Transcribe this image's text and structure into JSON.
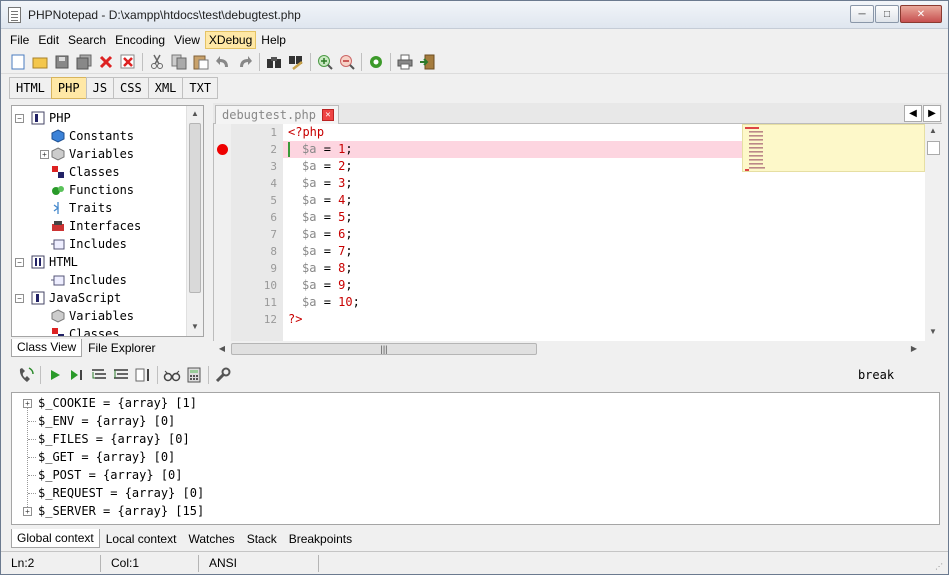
{
  "window": {
    "title": "PHPNotepad - D:\\xampp\\htdocs\\test\\debugtest.php"
  },
  "menu": [
    "File",
    "Edit",
    "Search",
    "Encoding",
    "View",
    "XDebug",
    "Help"
  ],
  "menu_active": "XDebug",
  "toolbar_icons": [
    "new-file-icon",
    "open-file-icon",
    "save-icon",
    "save-all-icon",
    "close-icon",
    "close-all-icon",
    "cut-icon",
    "copy-icon",
    "paste-icon",
    "undo-icon",
    "redo-icon",
    "find-icon",
    "replace-icon",
    "zoom-in-icon",
    "zoom-out-icon",
    "settings-icon",
    "print-icon",
    "exit-icon"
  ],
  "lang_tabs": [
    "HTML",
    "PHP",
    "JS",
    "CSS",
    "XML",
    "TXT"
  ],
  "lang_active": "PHP",
  "tree": {
    "php_root": "PHP",
    "php_children": [
      "Constants",
      "Variables",
      "Classes",
      "Functions",
      "Traits",
      "Interfaces",
      "Includes"
    ],
    "html_root": "HTML",
    "html_children": [
      "Includes"
    ],
    "js_root": "JavaScript",
    "js_children": [
      "Variables",
      "Classes"
    ]
  },
  "left_tabs": [
    "Class View",
    "File Explorer"
  ],
  "editor": {
    "tab_name": "debugtest.php",
    "open_tag": "<?php",
    "close_tag": "?>",
    "assign_var": "$a",
    "assign_op": "=",
    "assign_values": [
      "1",
      "2",
      "3",
      "4",
      "5",
      "6",
      "7",
      "8",
      "9",
      "10"
    ],
    "line_numbers": [
      "1",
      "2",
      "3",
      "4",
      "5",
      "6",
      "7",
      "8",
      "9",
      "10",
      "11",
      "12"
    ],
    "current_line": 2,
    "breakpoint_line": 2
  },
  "debug": {
    "status": "break",
    "variables": [
      "$_COOKIE = {array} [1]",
      "$_ENV = {array} [0]",
      "$_FILES = {array} [0]",
      "$_GET = {array} [0]",
      "$_POST = {array} [0]",
      "$_REQUEST = {array} [0]",
      "$_SERVER = {array} [15]"
    ]
  },
  "bottom_tabs": [
    "Global context",
    "Local context",
    "Watches",
    "Stack",
    "Breakpoints"
  ],
  "status": {
    "line": "Ln:2",
    "col": "Col:1",
    "encoding": "ANSI"
  },
  "colors": {
    "accent_active": "#ffe8a6",
    "current_line": "#fdd5e0",
    "breakpoint": "#ee0000",
    "keyword": "#c80000",
    "minimap": "#fdf8c9"
  }
}
